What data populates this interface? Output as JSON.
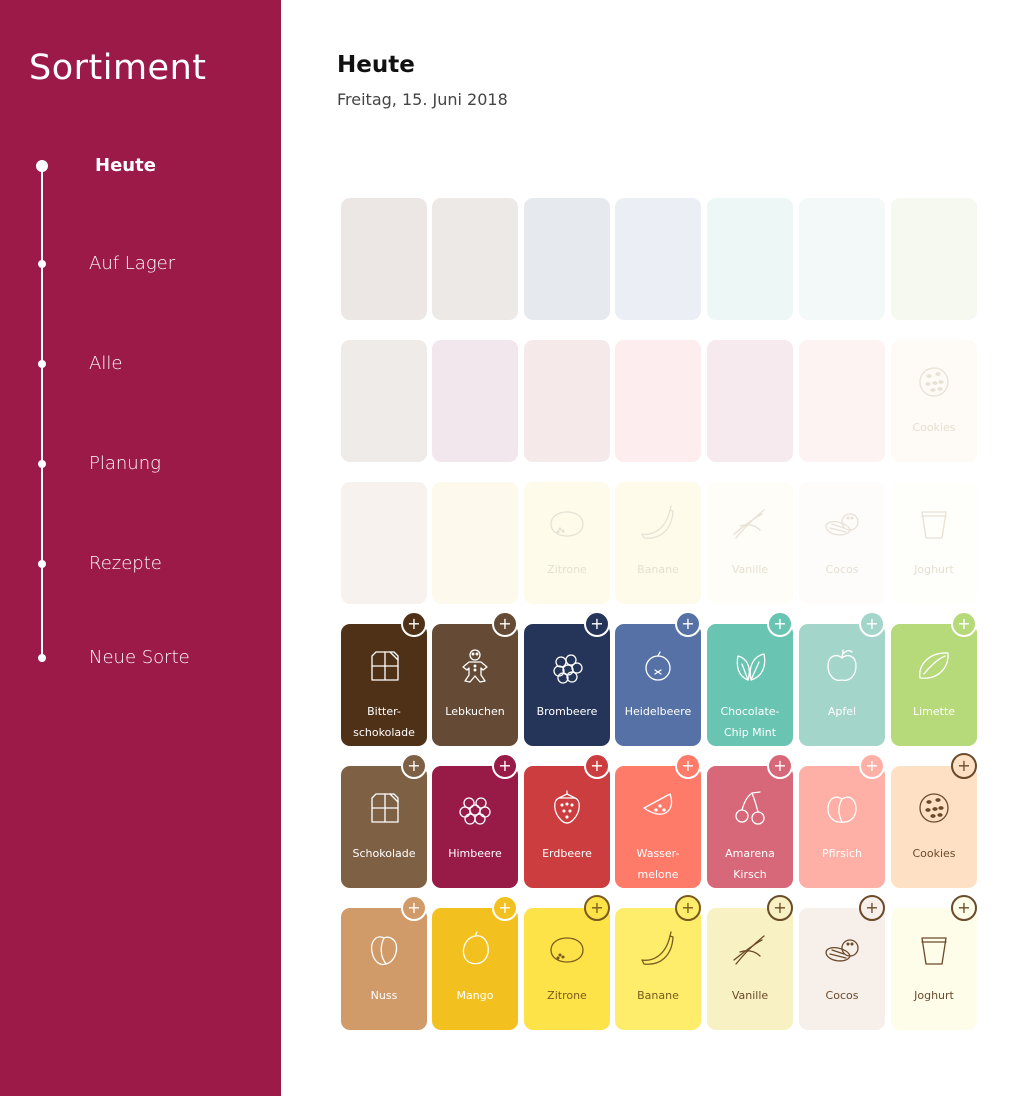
{
  "sidebar": {
    "title": "Sortiment",
    "items": [
      {
        "label": "Heute",
        "active": true
      },
      {
        "label": "Auf Lager"
      },
      {
        "label": "Alle"
      },
      {
        "label": "Planung"
      },
      {
        "label": "Rezepte"
      },
      {
        "label": "Neue Sorte"
      }
    ]
  },
  "header": {
    "title": "Heute",
    "date": "Freitag, 15. Juni 2018"
  },
  "ghost_rows": [
    [
      {
        "color": "#ece7e4"
      },
      {
        "color": "#ede9e6"
      },
      {
        "color": "#e6e9ee"
      },
      {
        "color": "#ebeff5"
      },
      {
        "color": "#edf7f5"
      },
      {
        "color": "#f3f8f8"
      },
      {
        "color": "#f5f9ef"
      }
    ],
    [
      {
        "color": "#efebe9"
      },
      {
        "color": "#f1e7ed"
      },
      {
        "color": "#f6e9ea"
      },
      {
        "color": "#fdedee"
      },
      {
        "color": "#f6eaee"
      },
      {
        "color": "#fdf3f2"
      },
      {
        "color": "#fefaf6",
        "label": "Cookies",
        "icon": "cookie-icon"
      }
    ],
    [
      {
        "color": "#f7f2ee"
      },
      {
        "color": "#fdf9ec"
      },
      {
        "color": "#fefbea",
        "label": "Zitrone",
        "icon": "lemon-icon"
      },
      {
        "color": "#fefbeb",
        "label": "Banane",
        "icon": "banana-icon"
      },
      {
        "color": "#fefdf8",
        "label": "Vanille",
        "icon": "vanilla-icon"
      },
      {
        "color": "#fefcfb",
        "label": "Cocos",
        "icon": "coconut-icon"
      },
      {
        "color": "#fefefa",
        "label": "Joghurt",
        "icon": "yogurt-icon"
      }
    ]
  ],
  "flavor_rows": [
    [
      {
        "label": "Bitter-\nschokolade",
        "icon": "chocolate-icon",
        "color": "#4e3117",
        "text_color": "#ffffff",
        "button_color": "#4e3117"
      },
      {
        "label": "Lebkuchen",
        "icon": "gingerbread-icon",
        "color": "#654b35",
        "text_color": "#ffffff",
        "button_color": "#654b35"
      },
      {
        "label": "Brombeere",
        "icon": "blackberry-icon",
        "color": "#243559",
        "text_color": "#ffffff",
        "button_color": "#243559"
      },
      {
        "label": "Heidelbeere",
        "icon": "blueberry-icon",
        "color": "#5571a6",
        "text_color": "#ffffff",
        "button_color": "#5571a6"
      },
      {
        "label": "Chocolate-\nChip Mint",
        "icon": "mint-leaf-icon",
        "color": "#69c4b2",
        "text_color": "#ffffff",
        "button_color": "#69c4b2"
      },
      {
        "label": "Apfel",
        "icon": "apple-icon",
        "color": "#a3d5cb",
        "text_color": "#ffffff",
        "button_color": "#a3d5cb"
      },
      {
        "label": "Limette",
        "icon": "lime-icon",
        "color": "#b6d979",
        "text_color": "#ffffff",
        "button_color": "#b6d979"
      }
    ],
    [
      {
        "label": "Schokolade",
        "icon": "chocolate-icon",
        "color": "#7e6145",
        "text_color": "#ffffff",
        "button_color": "#7e6145"
      },
      {
        "label": "Himbeere",
        "icon": "raspberry-icon",
        "color": "#981a47",
        "text_color": "#ffffff",
        "button_color": "#981a47"
      },
      {
        "label": "Erdbeere",
        "icon": "strawberry-icon",
        "color": "#cc3d3f",
        "text_color": "#ffffff",
        "button_color": "#cc3d3f"
      },
      {
        "label": "Wasser-\nmelone",
        "icon": "watermelon-icon",
        "color": "#fe7b6a",
        "text_color": "#ffffff",
        "button_color": "#fe7b6a"
      },
      {
        "label": "Amarena\nKirsch",
        "icon": "cherry-icon",
        "color": "#d66879",
        "text_color": "#ffffff",
        "button_color": "#d66879"
      },
      {
        "label": "Pfirsich",
        "icon": "peach-icon",
        "color": "#feb0a6",
        "text_color": "#ffffff",
        "button_color": "#feb0a6"
      },
      {
        "label": "Cookies",
        "icon": "cookie-icon",
        "color": "#fee1c4",
        "text_color": "#6b4a2a",
        "button_color": "#fee1c4"
      }
    ],
    [
      {
        "label": "Nuss",
        "icon": "nut-icon",
        "color": "#d09b68",
        "text_color": "#ffffff",
        "button_color": "#d09b68"
      },
      {
        "label": "Mango",
        "icon": "mango-icon",
        "color": "#f3c11f",
        "text_color": "#ffffff",
        "button_color": "#f3c11f"
      },
      {
        "label": "Zitrone",
        "icon": "lemon-icon",
        "color": "#fde348",
        "text_color": "#7a5a1e",
        "button_color": "#fde348"
      },
      {
        "label": "Banane",
        "icon": "banana-icon",
        "color": "#feed6b",
        "text_color": "#7a5a1e",
        "button_color": "#feed6b"
      },
      {
        "label": "Vanille",
        "icon": "vanilla-icon",
        "color": "#f8f1c3",
        "text_color": "#6b4a2a",
        "button_color": "#f8f1c3"
      },
      {
        "label": "Cocos",
        "icon": "coconut-icon",
        "color": "#f7efea",
        "text_color": "#6b4a2a",
        "button_color": "#f7efea"
      },
      {
        "label": "Joghurt",
        "icon": "yogurt-icon",
        "color": "#fefdea",
        "text_color": "#6b4a2a",
        "button_color": "#fefdea"
      }
    ]
  ]
}
